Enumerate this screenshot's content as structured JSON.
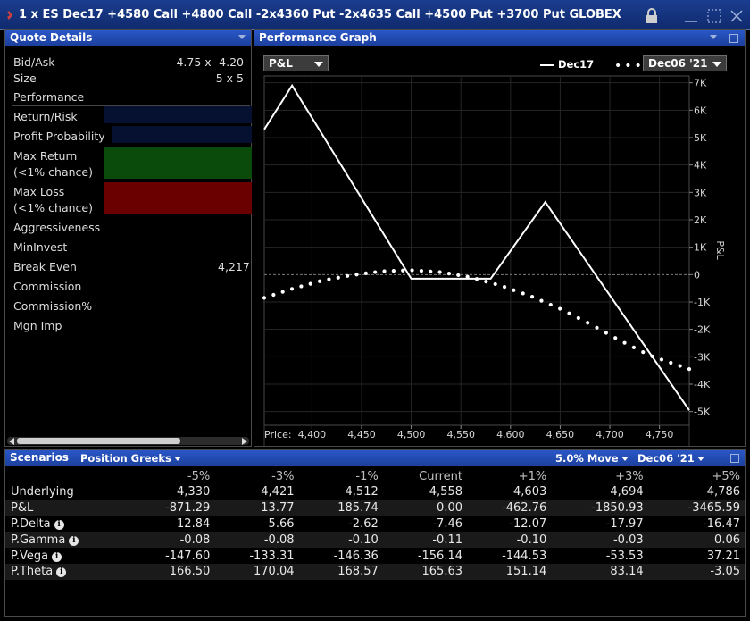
{
  "window": {
    "title": "1 x ES Dec17  +4580 Call  +4800 Call  -2x4360 Put  -2x4635 Call  +4500 Put  +3700 Put GLOBEX",
    "icons": [
      "app-icon",
      "lock-icon",
      "minimize-icon",
      "maximize-icon",
      "close-icon"
    ]
  },
  "quote_details": {
    "title": "Quote Details",
    "bid_ask_label": "Bid/Ask",
    "bid_ask_value": "-4.75 x -4.20",
    "size_label": "Size",
    "size_value": "5 x 5",
    "performance_label": "Performance",
    "rows": {
      "return_risk": "Return/Risk",
      "profit_probability": "Profit Probability",
      "max_return": "Max Return",
      "max_return_sub": "(<1% chance)",
      "max_loss": "Max Loss",
      "max_loss_sub": "(<1% chance)",
      "aggressiveness": "Aggressiveness",
      "mininvest": "MinInvest",
      "break_even": "Break Even",
      "break_even_value": "4,217",
      "commission": "Commission",
      "commission_pct": "Commission%",
      "mgn_imp": "Mgn Imp"
    },
    "colors": {
      "return_bar": "#061030",
      "max_return_bar": "#0a4a0a",
      "max_loss_bar": "#6a0000"
    }
  },
  "performance_graph": {
    "title": "Performance Graph",
    "metric_dropdown": "P&L",
    "legend_solid": "Dec17",
    "date_dropdown": "Dec06 '21"
  },
  "chart_data": {
    "type": "line",
    "xlabel": "Price:",
    "ylabel": "P&L",
    "x_ticks": [
      "4,400",
      "4,450",
      "4,500",
      "4,550",
      "4,600",
      "4,650",
      "4,700",
      "4,750"
    ],
    "y_ticks": [
      "7K",
      "6K",
      "5K",
      "4K",
      "3K",
      "2K",
      "1K",
      "0",
      "-1K",
      "-2K",
      "-3K",
      "-4K",
      "-5K"
    ],
    "xlim": [
      4352,
      4780
    ],
    "ylim": [
      -5500,
      7250
    ],
    "series": [
      {
        "name": "Dec17",
        "style": "solid",
        "x": [
          4352,
          4380,
          4500,
          4580,
          4635,
          4780
        ],
        "y": [
          5300,
          6900,
          -150,
          -150,
          2650,
          -4950
        ]
      },
      {
        "style": "dotted",
        "x": [
          4352,
          4380,
          4410,
          4440,
          4470,
          4500,
          4530,
          4560,
          4590,
          4620,
          4650,
          4680,
          4710,
          4740,
          4780
        ],
        "y": [
          -850,
          -520,
          -220,
          -20,
          120,
          160,
          90,
          -100,
          -400,
          -780,
          -1250,
          -1800,
          -2400,
          -2950,
          -3450
        ]
      }
    ]
  },
  "scenarios": {
    "title": "Scenarios",
    "greeks_dropdown": "Position Greeks",
    "move_dropdown": "5.0% Move",
    "date_dropdown": "Dec06 '21",
    "columns": [
      "-5%",
      "-3%",
      "-1%",
      "Current",
      "+1%",
      "+3%",
      "+5%"
    ],
    "rows": [
      {
        "label": "Underlying",
        "info": false,
        "values": [
          "4,330",
          "4,421",
          "4,512",
          "4,558",
          "4,603",
          "4,694",
          "4,786"
        ]
      },
      {
        "label": "P&L",
        "info": false,
        "values": [
          "-871.29",
          "13.77",
          "185.74",
          "0.00",
          "-462.76",
          "-1850.93",
          "-3465.59"
        ]
      },
      {
        "label": "P.Delta",
        "info": true,
        "values": [
          "12.84",
          "5.66",
          "-2.62",
          "-7.46",
          "-12.07",
          "-17.97",
          "-16.47"
        ]
      },
      {
        "label": "P.Gamma",
        "info": true,
        "values": [
          "-0.08",
          "-0.08",
          "-0.10",
          "-0.11",
          "-0.10",
          "-0.03",
          "0.06"
        ]
      },
      {
        "label": "P.Vega",
        "info": true,
        "values": [
          "-147.60",
          "-133.31",
          "-146.36",
          "-156.14",
          "-144.53",
          "-53.53",
          "37.21"
        ]
      },
      {
        "label": "P.Theta",
        "info": true,
        "values": [
          "166.50",
          "170.04",
          "168.57",
          "165.63",
          "151.14",
          "83.14",
          "-3.05"
        ]
      }
    ]
  }
}
